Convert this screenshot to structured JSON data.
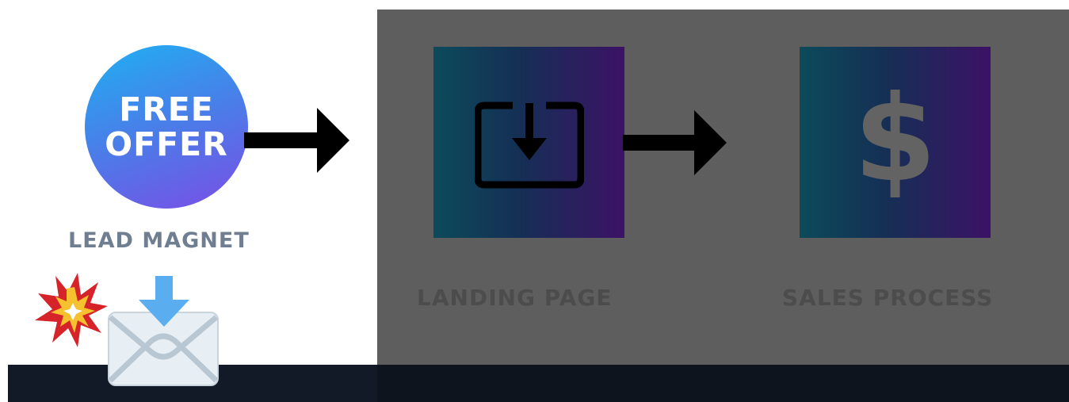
{
  "lead_magnet": {
    "badge_line1": "FREE",
    "badge_line2": "OFFER",
    "caption": "LEAD MAGNET"
  },
  "landing_page": {
    "caption": "LANDING PAGE",
    "icon": "download-tray-icon"
  },
  "sales_process": {
    "caption": "SALES PROCESS",
    "symbol": "$"
  },
  "icons": [
    "arrow-right-icon",
    "download-tray-icon",
    "dollar-icon",
    "explosion-icon",
    "incoming-envelope-icon"
  ],
  "colors": {
    "badge_gradient": [
      "#1fb0f2",
      "#4a7de8",
      "#7a4ee6"
    ],
    "tile_gradient": [
      "#0c4b5a",
      "#152f55",
      "#3c1266"
    ],
    "overlay": "#5e5e5e",
    "bottom_bar": "#111a26",
    "caption_light": "#6f7f91",
    "caption_dim": "#4c4c4c"
  }
}
